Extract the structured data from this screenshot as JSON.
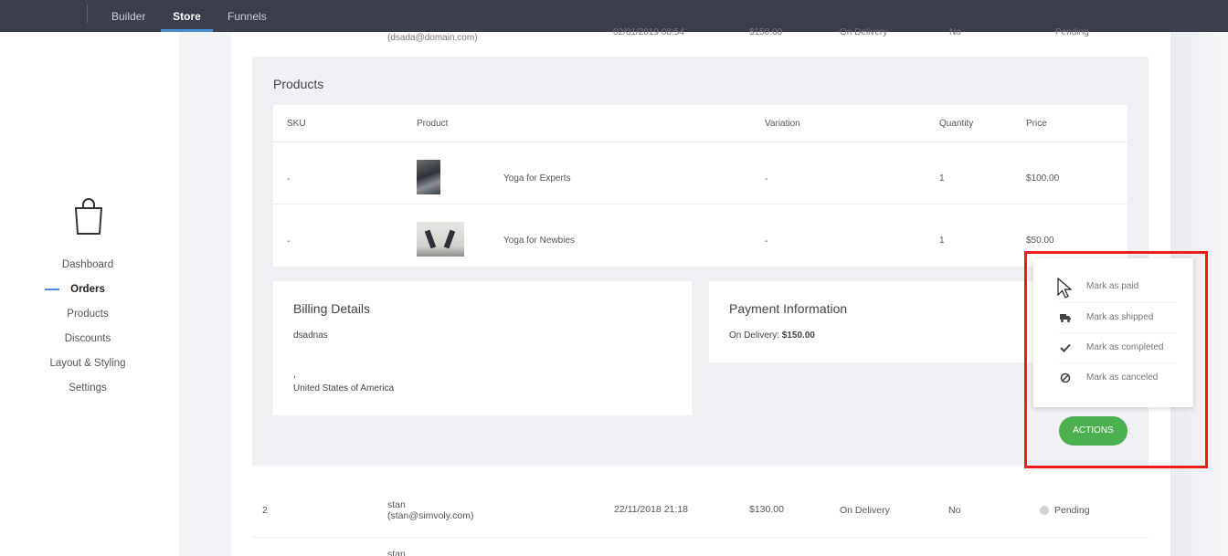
{
  "topbar": {
    "builder": "Builder",
    "store": "Store",
    "funnels": "Funnels"
  },
  "sidebar": {
    "items": [
      "Dashboard",
      "Orders",
      "Products",
      "Discounts",
      "Layout & Styling",
      "Settings"
    ],
    "active": "Orders"
  },
  "prev_order": {
    "email": "(dsada@domain.com)",
    "date": "02/01/2019 08:54",
    "total": "$150.00",
    "payment": "On Delivery",
    "paid": "No",
    "status": "Pending"
  },
  "products": {
    "title": "Products",
    "columns": [
      "SKU",
      "Product",
      "Variation",
      "Quantity",
      "Price"
    ],
    "rows": [
      {
        "sku": "-",
        "product": "Yoga for Experts",
        "variation": "-",
        "quantity": "1",
        "price": "$100.00"
      },
      {
        "sku": "-",
        "product": "Yoga for Newbies",
        "variation": "-",
        "quantity": "1",
        "price": "$50.00"
      }
    ]
  },
  "billing": {
    "title": "Billing Details",
    "name": "dsadnas",
    "line2": ",",
    "country": "United States of America"
  },
  "payment": {
    "title": "Payment Information",
    "method_label": "On Delivery: ",
    "amount": "$150.00"
  },
  "actions_menu": {
    "items": [
      {
        "icon": "cursor-icon",
        "label": "Mark as paid"
      },
      {
        "icon": "truck-icon",
        "label": "Mark as shipped"
      },
      {
        "icon": "check-icon",
        "label": "Mark as completed"
      },
      {
        "icon": "ban-icon",
        "label": "Mark as canceled"
      }
    ],
    "button": "ACTIONS"
  },
  "orders": [
    {
      "id": "2",
      "name": "stan",
      "email": "(stan@simvoly.com)",
      "date": "22/11/2018 21:18",
      "total": "$130.00",
      "payment": "On Delivery",
      "paid": "No",
      "status": "Pending"
    },
    {
      "name": "stan"
    }
  ],
  "colors": {
    "accent": "#4a8fd6",
    "success": "#4caf50",
    "highlight": "#ee1c1c",
    "topbar": "#3a3f4b"
  }
}
